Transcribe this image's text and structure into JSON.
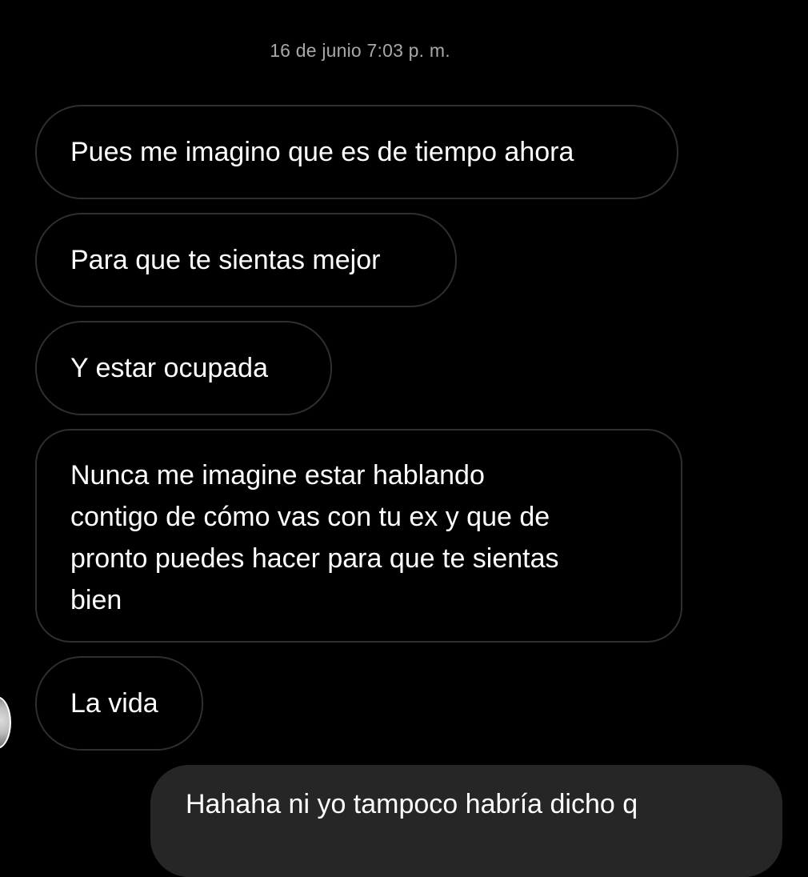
{
  "conversation": {
    "timestamp": "16 de junio 7:03 p. m.",
    "received_messages": [
      {
        "text": "Pues me imagino que es de tiempo ahora"
      },
      {
        "text": "Para que te sientas mejor"
      },
      {
        "text": "Y estar ocupada"
      },
      {
        "lines": [
          "Nunca me imagine estar hablando",
          "contigo de cómo vas con tu ex y que de",
          "pronto puedes hacer para que te sientas",
          "bien"
        ]
      },
      {
        "text": "La vida"
      }
    ],
    "sent_messages": [
      {
        "text": "Hahaha ni yo tampoco habría dicho q"
      }
    ]
  },
  "colors": {
    "background": "#000000",
    "received_bubble_border": "#2f2f2f",
    "sent_bubble_bg": "#262626",
    "timestamp_text": "#a8a8a8"
  }
}
